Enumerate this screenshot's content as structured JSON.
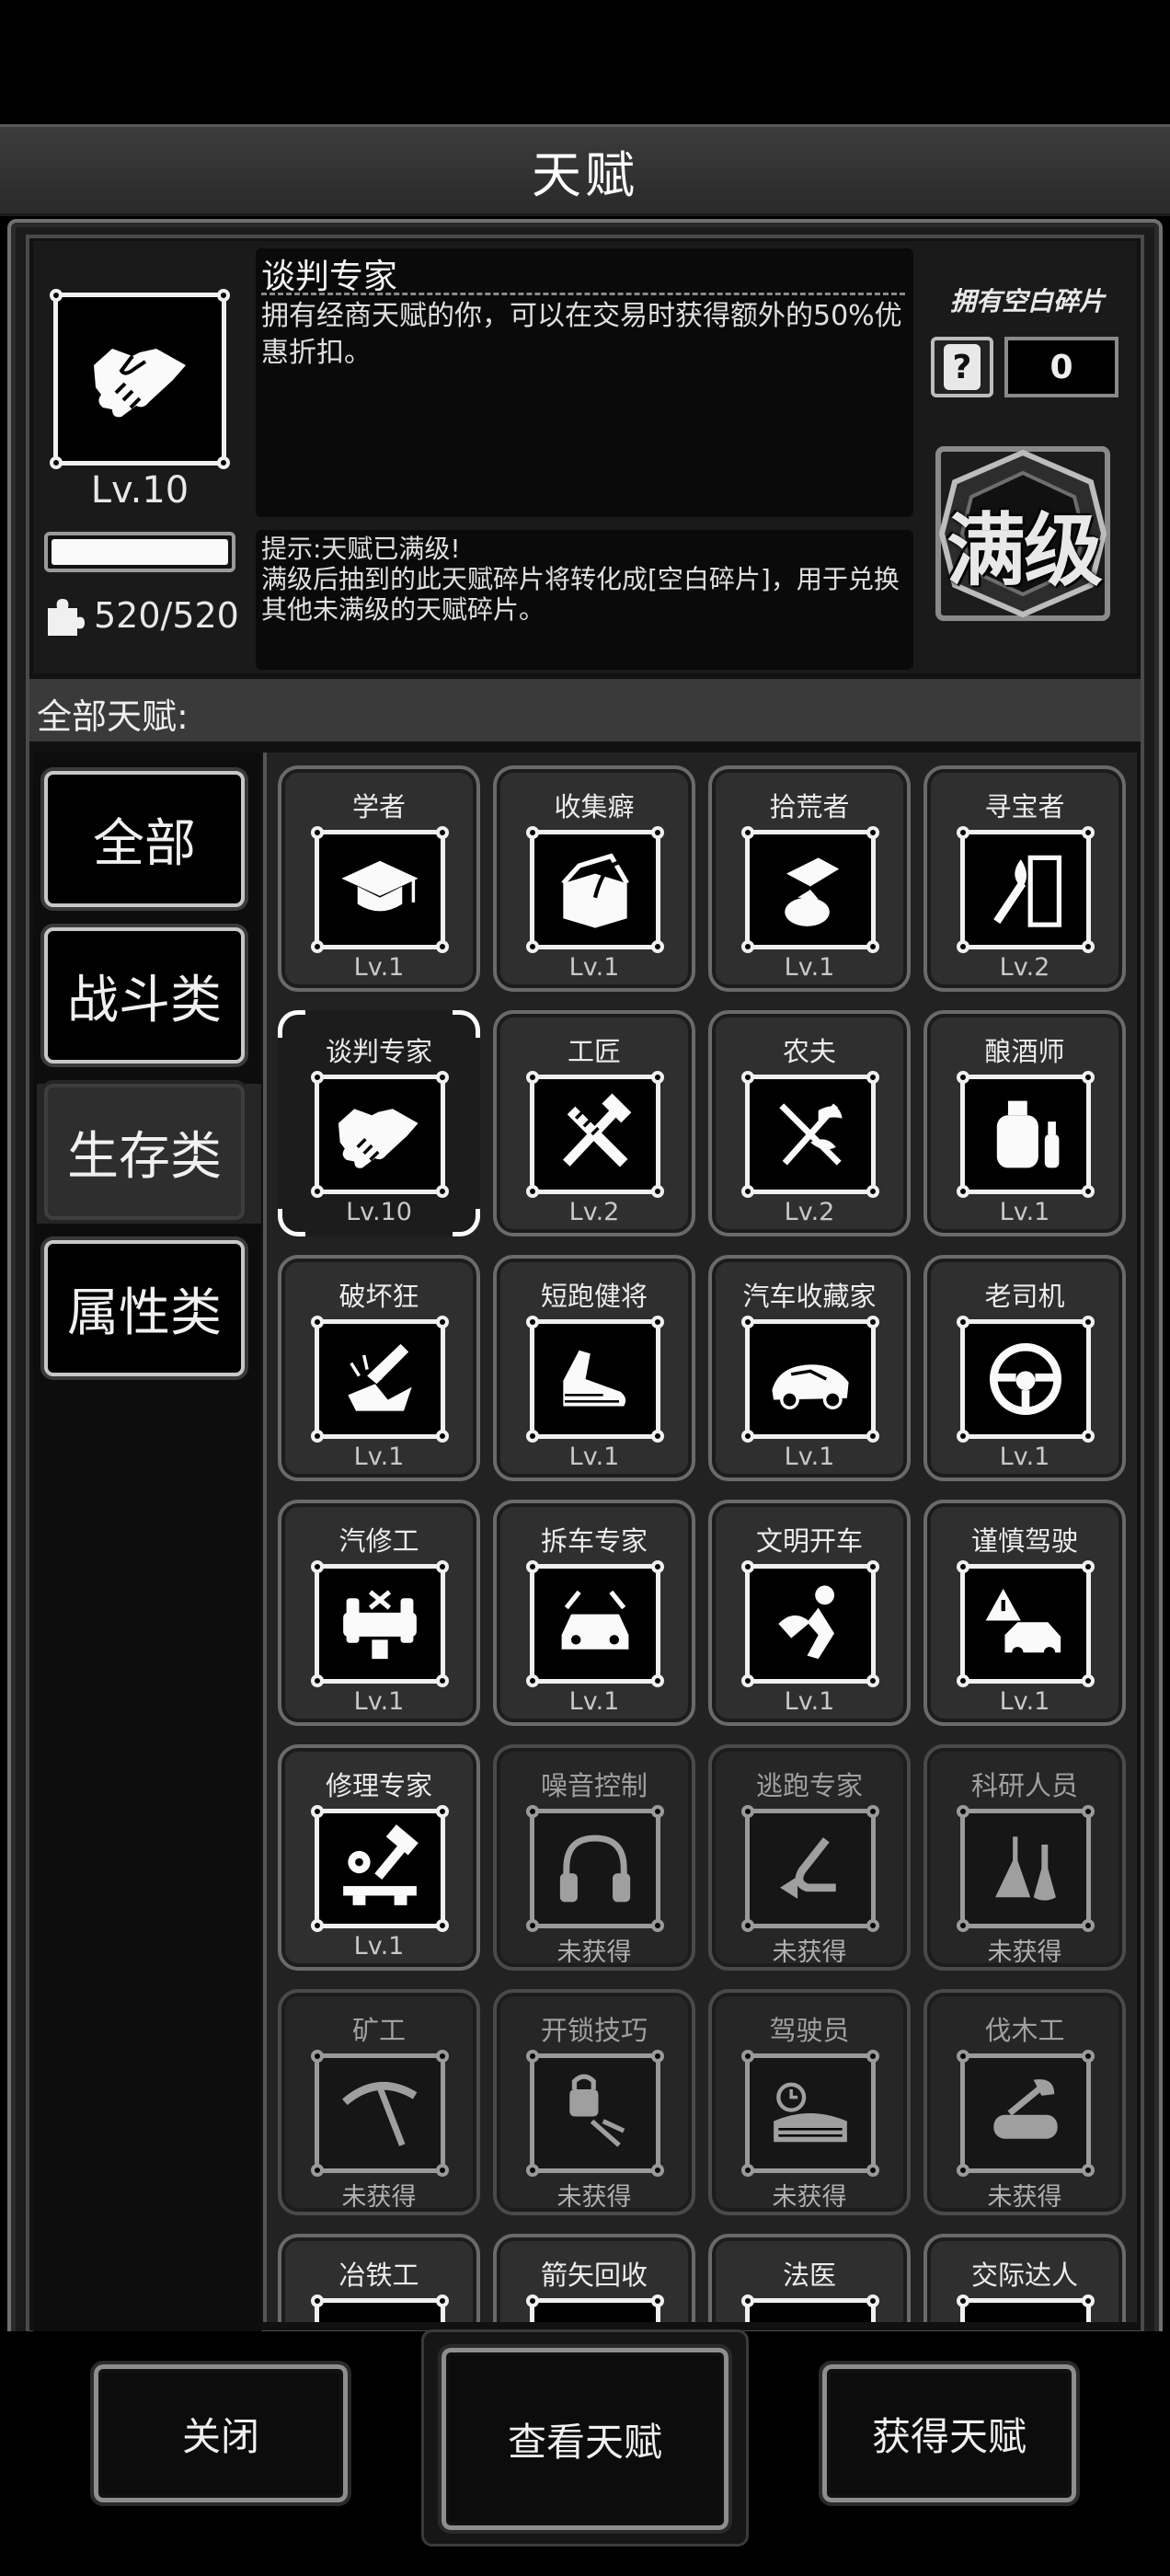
{
  "title": "天赋",
  "selected": {
    "name": "谈判专家",
    "description": "拥有经商天赋的你，可以在交易时获得额外的50%优惠折扣。",
    "level": "Lv.10",
    "progress": 1.0,
    "shards": "520/520",
    "hint": "提示:天赋已满级!\n满级后抽到的此天赋碎片将转化成[空白碎片]，用于兑换其他未满级的天赋碎片。",
    "icon": "handshake-icon"
  },
  "blank_shards": {
    "label": "拥有空白碎片",
    "count": "0",
    "icon": "question-shard-icon"
  },
  "max_badge": "满级",
  "all_label": "全部天赋:",
  "categories": [
    {
      "label": "全部",
      "active": false
    },
    {
      "label": "战斗类",
      "active": false
    },
    {
      "label": "生存类",
      "active": true
    },
    {
      "label": "属性类",
      "active": false
    }
  ],
  "talents": [
    {
      "name": "学者",
      "level": "Lv.1",
      "icon": "graduation-cap-icon",
      "locked": false,
      "selected": false
    },
    {
      "name": "收集癖",
      "level": "Lv.1",
      "icon": "box-icon",
      "locked": false,
      "selected": false
    },
    {
      "name": "拾荒者",
      "level": "Lv.1",
      "icon": "scavenge-hand-icon",
      "locked": false,
      "selected": false
    },
    {
      "name": "寻宝者",
      "level": "Lv.2",
      "icon": "torch-door-icon",
      "locked": false,
      "selected": false
    },
    {
      "name": "谈判专家",
      "level": "Lv.10",
      "icon": "handshake-icon",
      "locked": false,
      "selected": true
    },
    {
      "name": "工匠",
      "level": "Lv.2",
      "icon": "hammer-saw-icon",
      "locked": false,
      "selected": false
    },
    {
      "name": "农夫",
      "level": "Lv.2",
      "icon": "farm-tools-icon",
      "locked": false,
      "selected": false
    },
    {
      "name": "酿酒师",
      "level": "Lv.1",
      "icon": "brewing-tank-icon",
      "locked": false,
      "selected": false
    },
    {
      "name": "破坏狂",
      "level": "Lv.1",
      "icon": "smash-icon",
      "locked": false,
      "selected": false
    },
    {
      "name": "短跑健将",
      "level": "Lv.1",
      "icon": "running-shoe-icon",
      "locked": false,
      "selected": false
    },
    {
      "name": "汽车收藏家",
      "level": "Lv.1",
      "icon": "sports-car-icon",
      "locked": false,
      "selected": false
    },
    {
      "name": "老司机",
      "level": "Lv.1",
      "icon": "steering-wheel-icon",
      "locked": false,
      "selected": false
    },
    {
      "name": "汽修工",
      "level": "Lv.1",
      "icon": "car-lift-icon",
      "locked": false,
      "selected": false
    },
    {
      "name": "拆车专家",
      "level": "Lv.1",
      "icon": "car-dismantle-icon",
      "locked": false,
      "selected": false
    },
    {
      "name": "文明开车",
      "level": "Lv.1",
      "icon": "driver-seat-icon",
      "locked": false,
      "selected": false
    },
    {
      "name": "谨慎驾驶",
      "level": "Lv.1",
      "icon": "warning-car-icon",
      "locked": false,
      "selected": false
    },
    {
      "name": "修理专家",
      "level": "Lv.1",
      "icon": "repair-hammer-icon",
      "locked": false,
      "selected": false
    },
    {
      "name": "噪音控制",
      "level": "未获得",
      "icon": "headphones-icon",
      "locked": true,
      "selected": false
    },
    {
      "name": "逃跑专家",
      "level": "未获得",
      "icon": "escape-arrow-icon",
      "locked": true,
      "selected": false
    },
    {
      "name": "科研人员",
      "level": "未获得",
      "icon": "flask-icon",
      "locked": true,
      "selected": false
    },
    {
      "name": "矿工",
      "level": "未获得",
      "icon": "pickaxe-icon",
      "locked": true,
      "selected": false
    },
    {
      "name": "开锁技巧",
      "level": "未获得",
      "icon": "lockpick-icon",
      "locked": true,
      "selected": false
    },
    {
      "name": "驾驶员",
      "level": "未获得",
      "icon": "speed-clock-icon",
      "locked": true,
      "selected": false
    },
    {
      "name": "伐木工",
      "level": "未获得",
      "icon": "axe-log-icon",
      "locked": true,
      "selected": false
    },
    {
      "name": "冶铁工",
      "level": "",
      "icon": "smelting-icon",
      "locked": false,
      "selected": false
    },
    {
      "name": "箭矢回收",
      "level": "",
      "icon": "arrow-icon",
      "locked": false,
      "selected": false
    },
    {
      "name": "法医",
      "level": "",
      "icon": "forensic-icon",
      "locked": false,
      "selected": false
    },
    {
      "name": "交际达人",
      "level": "",
      "icon": "social-icon",
      "locked": false,
      "selected": false
    }
  ],
  "buttons": {
    "close": "关闭",
    "view": "查看天赋",
    "obtain": "获得天赋"
  }
}
